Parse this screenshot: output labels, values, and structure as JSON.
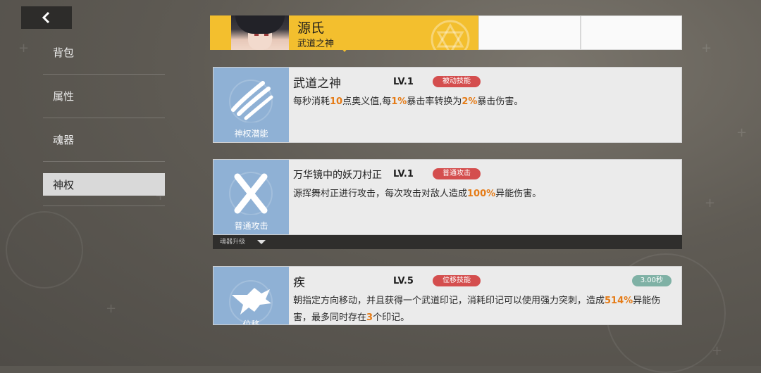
{
  "nav": {
    "back_icon": "chevron-left-icon"
  },
  "sidebar": {
    "items": [
      {
        "label": "背包",
        "active": false
      },
      {
        "label": "属性",
        "active": false
      },
      {
        "label": "魂器",
        "active": false
      },
      {
        "label": "神权",
        "active": true
      }
    ]
  },
  "character": {
    "name": "源氏",
    "title": "武道之神"
  },
  "skills": [
    {
      "icon": "claw-slash-icon",
      "icon_label": "神权潜能",
      "name": "武道之神",
      "level": "LV.1",
      "type": "被动技能",
      "desc": [
        {
          "t": "每秒消耗",
          "hl": false
        },
        {
          "t": "10",
          "hl": true
        },
        {
          "t": "点奥义值,每",
          "hl": false
        },
        {
          "t": "1%",
          "hl": true
        },
        {
          "t": "暴击率转换为",
          "hl": false
        },
        {
          "t": "2%",
          "hl": true
        },
        {
          "t": "暴击伤害。",
          "hl": false
        }
      ]
    },
    {
      "icon": "cross-slash-icon",
      "icon_label": "普通攻击",
      "name": "万华镜中的妖刀村正",
      "level": "LV.1",
      "type": "普通攻击",
      "desc": [
        {
          "t": "源挥舞村正进行攻击，每次攻击对敌人造成",
          "hl": false
        },
        {
          "t": "100%",
          "hl": true
        },
        {
          "t": "异能伤害。",
          "hl": false
        }
      ]
    },
    {
      "icon": "dragon-dash-icon",
      "icon_label": "位移",
      "name": "疾",
      "level": "LV.5",
      "type": "位移技能",
      "cooldown": "3.00秒",
      "desc": [
        {
          "t": "朝指定方向移动，并且获得一个武道印记，消耗印记可以使用强力突刺，造成",
          "hl": false
        },
        {
          "t": "514%",
          "hl": true
        },
        {
          "t": "异能伤害，最多同时存在",
          "hl": false
        },
        {
          "t": "3",
          "hl": true
        },
        {
          "t": "个印记。",
          "hl": false
        }
      ]
    }
  ],
  "upgrade_bar": {
    "label": "魂器升级",
    "icon": "caret-down-icon"
  },
  "colors": {
    "tab_active": "#f3bf2e",
    "icon_box": "#8fb1d5",
    "badge": "#d44e4e",
    "highlight": "#e57b16",
    "cooldown": "#7fb1a5"
  }
}
